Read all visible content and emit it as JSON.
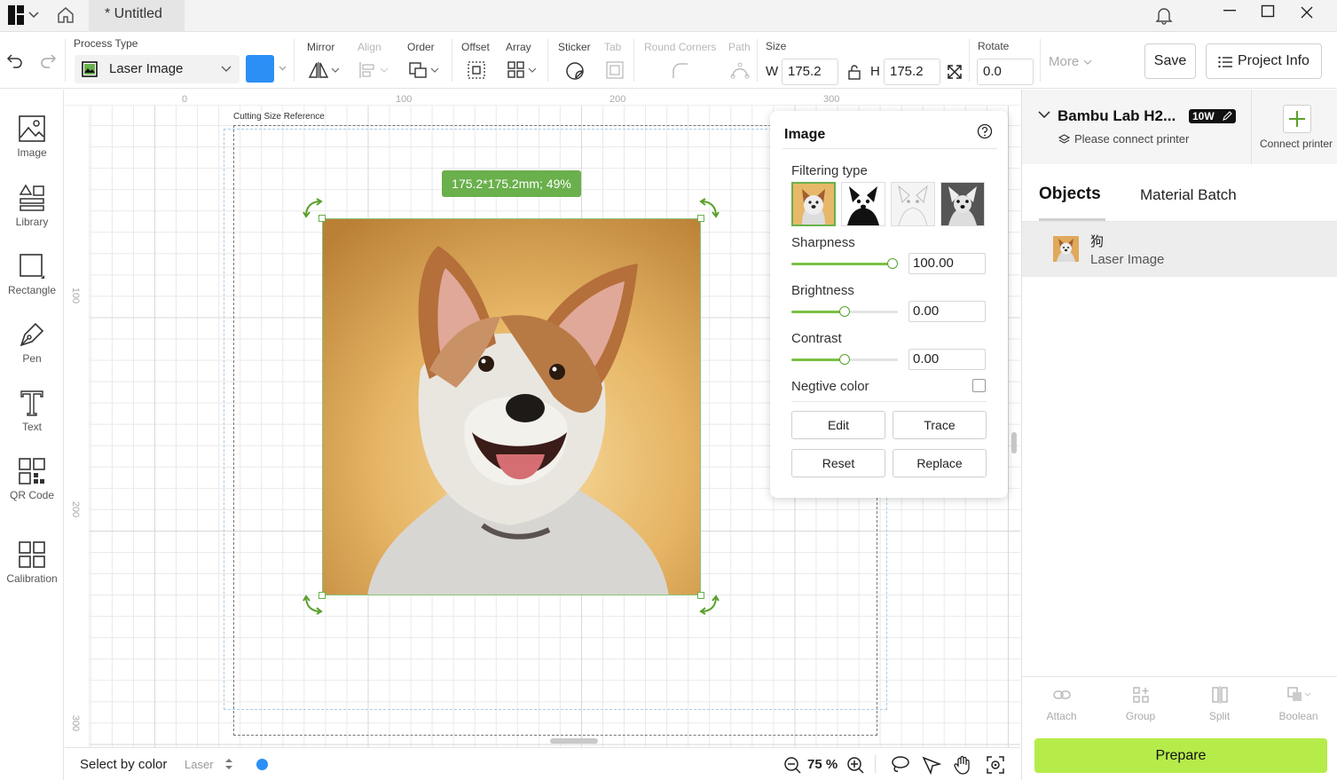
{
  "titlebar": {
    "tab_title": "* Untitled",
    "icons": [
      "logo-icon",
      "chevron-down-icon",
      "home-icon",
      "bell-icon",
      "minimize-icon",
      "maximize-icon",
      "close-icon"
    ]
  },
  "toolbar": {
    "process_type_label": "Process Type",
    "process_type_value": "Laser Image",
    "color_swatch": "#2b8ff5",
    "mirror_label": "Mirror",
    "align_label": "Align",
    "order_label": "Order",
    "offset_label": "Offset",
    "array_label": "Array",
    "sticker_label": "Sticker",
    "tab_label": "Tab",
    "round_corners_label": "Round Corners",
    "path_label": "Path",
    "size_label": "Size",
    "w_label": "W",
    "w_value": "175.2",
    "h_label": "H",
    "h_value": "175.2",
    "rotate_label": "Rotate",
    "rotate_value": "0.0",
    "more_label": "More",
    "save_label": "Save",
    "project_info_label": "Project Info"
  },
  "left_tools": [
    {
      "label": "Image",
      "icon": "image-icon"
    },
    {
      "label": "Library",
      "icon": "library-icon"
    },
    {
      "label": "Rectangle",
      "icon": "rectangle-icon"
    },
    {
      "label": "Pen",
      "icon": "pen-icon"
    },
    {
      "label": "Text",
      "icon": "text-icon"
    },
    {
      "label": "QR Code",
      "icon": "qr-code-icon"
    },
    {
      "label": "Calibration",
      "icon": "calibration-icon"
    }
  ],
  "canvas": {
    "ruler_top": [
      "0",
      "100",
      "200",
      "300"
    ],
    "ruler_left": [
      "100",
      "200",
      "300"
    ],
    "cutting_reference_label": "Cutting Size Reference",
    "size_badge": "175.2*175.2mm; 49%",
    "accent": "#6ab04c"
  },
  "image_panel": {
    "title": "Image",
    "filtering_type_label": "Filtering type",
    "sharpness_label": "Sharpness",
    "sharpness_value": "100.00",
    "sharpness_level": 1.0,
    "brightness_label": "Brightness",
    "brightness_value": "0.00",
    "brightness_level": 0.5,
    "contrast_label": "Contrast",
    "contrast_value": "0.00",
    "contrast_level": 0.5,
    "negative_label": "Negtive color",
    "edit_label": "Edit",
    "trace_label": "Trace",
    "reset_label": "Reset",
    "replace_label": "Replace"
  },
  "right_panel": {
    "printer_name": "Bambu Lab H2...",
    "printer_badge": "10W",
    "printer_status": "Please connect printer",
    "connect_printer_label": "Connect printer",
    "tab_objects": "Objects",
    "tab_material_batch": "Material Batch",
    "object_name": "狗",
    "object_type": "Laser Image",
    "attach_label": "Attach",
    "group_label": "Group",
    "split_label": "Split",
    "boolean_label": "Boolean",
    "prepare_label": "Prepare",
    "prepare_color": "#b5ec4a"
  },
  "statusbar": {
    "select_by_color_label": "Select by color",
    "layer_label": "Laser",
    "layer_color": "#2b8ff5",
    "zoom_value": "75 %"
  }
}
